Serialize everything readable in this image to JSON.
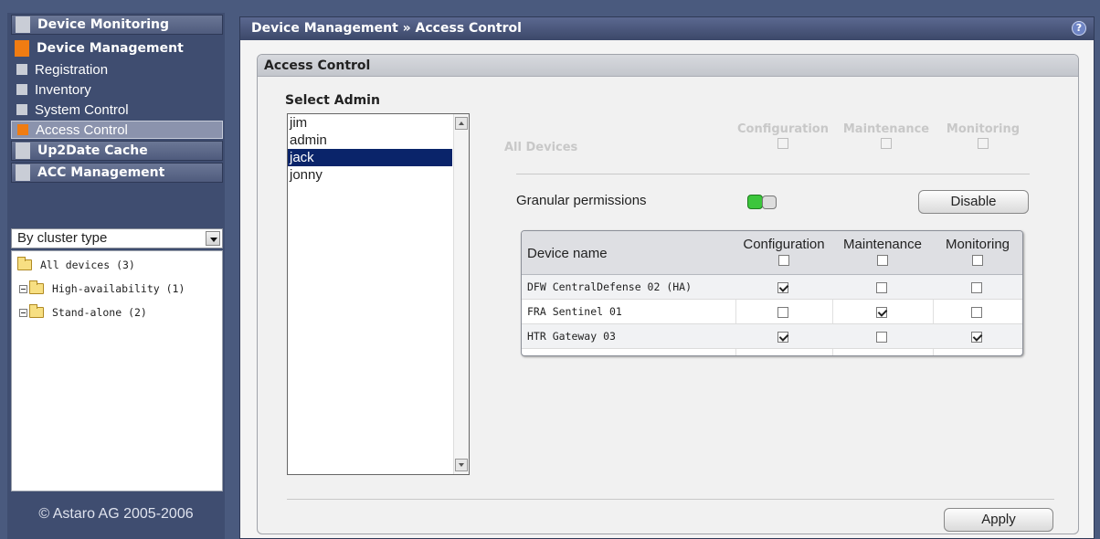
{
  "nav": {
    "device_monitoring": "Device Monitoring",
    "device_management": "Device Management",
    "subitems": [
      "Registration",
      "Inventory",
      "System Control",
      "Access Control"
    ],
    "up2date_cache": "Up2Date Cache",
    "acc_management": "ACC Management"
  },
  "cluster_select": {
    "value": "By cluster type"
  },
  "tree": {
    "root": "All devices (3)",
    "children": [
      "High-availability (1)",
      "Stand-alone (2)"
    ]
  },
  "copyright": "© Astaro AG 2005-2006",
  "header": {
    "breadcrumb": "Device Management » Access Control",
    "help": "?"
  },
  "panel": {
    "title": "Access Control",
    "select_admin_label": "Select Admin",
    "admins": [
      "jim",
      "admin",
      "jack",
      "jonny"
    ],
    "selected_admin": "jack",
    "all_devices_label": "All Devices",
    "columns": [
      "Configuration",
      "Maintenance",
      "Monitoring"
    ],
    "granular_label": "Granular permissions",
    "granular_enabled": true,
    "disable_button": "Disable",
    "apply_button": "Apply"
  },
  "device_table": {
    "headers": [
      "Device name",
      "Configuration",
      "Maintenance",
      "Monitoring"
    ],
    "rows": [
      {
        "name": "DFW CentralDefense 02 (HA)",
        "config": true,
        "maint": false,
        "monitor": false
      },
      {
        "name": "FRA Sentinel 01",
        "config": false,
        "maint": true,
        "monitor": false
      },
      {
        "name": "HTR Gateway 03",
        "config": true,
        "maint": false,
        "monitor": true
      }
    ]
  },
  "colors": {
    "accent": "#f07c12",
    "selected": "#0a246a",
    "toggle_on": "#3cc63c"
  }
}
